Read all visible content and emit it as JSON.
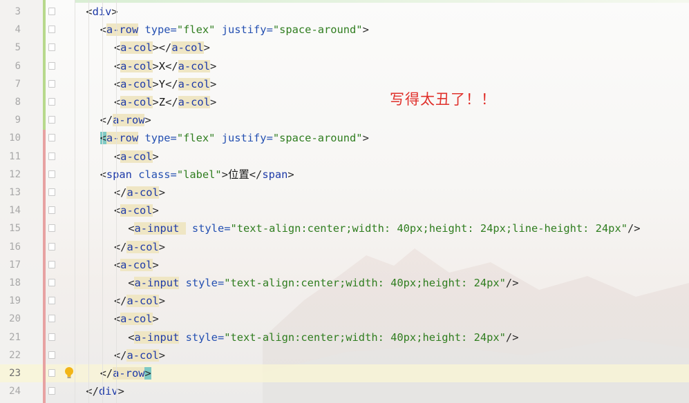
{
  "annotation": "写得太丑了！！",
  "editor": {
    "current_line": 23,
    "lines": [
      {
        "num": "3",
        "indent": 1,
        "tokens": [
          {
            "c": "t-br",
            "t": "<"
          },
          {
            "c": "t-tag",
            "t": "div"
          },
          {
            "c": "t-br",
            "t": ">"
          }
        ]
      },
      {
        "num": "4",
        "indent": 2,
        "tokens": [
          {
            "c": "t-br",
            "t": "<"
          },
          {
            "c": "t-tag",
            "t": "a-row",
            "hl": true
          },
          {
            "c": "t-attr",
            "t": " type="
          },
          {
            "c": "t-val",
            "t": "\"flex\""
          },
          {
            "c": "t-attr",
            "t": " justify="
          },
          {
            "c": "t-val",
            "t": "\"space-around\""
          },
          {
            "c": "t-br",
            "t": ">"
          }
        ]
      },
      {
        "num": "5",
        "indent": 3,
        "tokens": [
          {
            "c": "t-br",
            "t": "<"
          },
          {
            "c": "t-tag",
            "t": "a-col",
            "hl": true
          },
          {
            "c": "t-br",
            "t": "></"
          },
          {
            "c": "t-tag",
            "t": "a-col",
            "hl": true
          },
          {
            "c": "t-br",
            "t": ">"
          }
        ]
      },
      {
        "num": "6",
        "indent": 3,
        "tokens": [
          {
            "c": "t-br",
            "t": "<"
          },
          {
            "c": "t-tag",
            "t": "a-col",
            "hl": true
          },
          {
            "c": "t-br",
            "t": ">"
          },
          {
            "c": "t-text",
            "t": "X"
          },
          {
            "c": "t-br",
            "t": "</"
          },
          {
            "c": "t-tag",
            "t": "a-col",
            "hl": true
          },
          {
            "c": "t-br",
            "t": ">"
          }
        ]
      },
      {
        "num": "7",
        "indent": 3,
        "tokens": [
          {
            "c": "t-br",
            "t": "<"
          },
          {
            "c": "t-tag",
            "t": "a-col",
            "hl": true
          },
          {
            "c": "t-br",
            "t": ">"
          },
          {
            "c": "t-text",
            "t": "Y"
          },
          {
            "c": "t-br",
            "t": "</"
          },
          {
            "c": "t-tag",
            "t": "a-col",
            "hl": true
          },
          {
            "c": "t-br",
            "t": ">"
          }
        ]
      },
      {
        "num": "8",
        "indent": 3,
        "tokens": [
          {
            "c": "t-br",
            "t": "<"
          },
          {
            "c": "t-tag",
            "t": "a-col",
            "hl": true
          },
          {
            "c": "t-br",
            "t": ">"
          },
          {
            "c": "t-text",
            "t": "Z"
          },
          {
            "c": "t-br",
            "t": "</"
          },
          {
            "c": "t-tag",
            "t": "a-col",
            "hl": true
          },
          {
            "c": "t-br",
            "t": ">"
          }
        ]
      },
      {
        "num": "9",
        "indent": 2,
        "tokens": [
          {
            "c": "t-br",
            "t": "</"
          },
          {
            "c": "t-tag",
            "t": "a-row",
            "hl": true
          },
          {
            "c": "t-br",
            "t": ">"
          }
        ]
      },
      {
        "num": "10",
        "indent": 2,
        "tokens": [
          {
            "c": "t-br",
            "t": "<",
            "bhl": true
          },
          {
            "c": "t-tag",
            "t": "a-row",
            "hl": true
          },
          {
            "c": "t-attr",
            "t": " type="
          },
          {
            "c": "t-val",
            "t": "\"flex\""
          },
          {
            "c": "t-attr",
            "t": " justify="
          },
          {
            "c": "t-val",
            "t": "\"space-around\""
          },
          {
            "c": "t-br",
            "t": ">"
          }
        ]
      },
      {
        "num": "11",
        "indent": 3,
        "tokens": [
          {
            "c": "t-br",
            "t": "<"
          },
          {
            "c": "t-tag",
            "t": "a-col",
            "hl": true
          },
          {
            "c": "t-br",
            "t": ">"
          }
        ]
      },
      {
        "num": "12",
        "indent": 2,
        "tokens": [
          {
            "c": "t-br",
            "t": "<"
          },
          {
            "c": "t-tag",
            "t": "span"
          },
          {
            "c": "t-attr",
            "t": " class="
          },
          {
            "c": "t-val",
            "t": "\"label\""
          },
          {
            "c": "t-br",
            "t": ">"
          },
          {
            "c": "t-text",
            "t": "位置"
          },
          {
            "c": "t-br",
            "t": "</"
          },
          {
            "c": "t-tag",
            "t": "span"
          },
          {
            "c": "t-br",
            "t": ">"
          }
        ]
      },
      {
        "num": "13",
        "indent": 3,
        "tokens": [
          {
            "c": "t-br",
            "t": "</"
          },
          {
            "c": "t-tag",
            "t": "a-col",
            "hl": true
          },
          {
            "c": "t-br",
            "t": ">"
          }
        ]
      },
      {
        "num": "14",
        "indent": 3,
        "tokens": [
          {
            "c": "t-br",
            "t": "<"
          },
          {
            "c": "t-tag",
            "t": "a-col",
            "hl": true
          },
          {
            "c": "t-br",
            "t": ">"
          }
        ]
      },
      {
        "num": "15",
        "indent": 4,
        "tokens": [
          {
            "c": "t-br",
            "t": "<"
          },
          {
            "c": "t-tag",
            "t": "a-input ",
            "hl": true
          },
          {
            "c": "t-attr",
            "t": " style="
          },
          {
            "c": "t-val",
            "t": "\"text-align:center;width: 40px;height: 24px;line-height: 24px\""
          },
          {
            "c": "t-br",
            "t": "/>"
          }
        ]
      },
      {
        "num": "16",
        "indent": 3,
        "tokens": [
          {
            "c": "t-br",
            "t": "</"
          },
          {
            "c": "t-tag",
            "t": "a-col",
            "hl": true
          },
          {
            "c": "t-br",
            "t": ">"
          }
        ]
      },
      {
        "num": "17",
        "indent": 3,
        "tokens": [
          {
            "c": "t-br",
            "t": "<"
          },
          {
            "c": "t-tag",
            "t": "a-col",
            "hl": true
          },
          {
            "c": "t-br",
            "t": ">"
          }
        ]
      },
      {
        "num": "18",
        "indent": 4,
        "tokens": [
          {
            "c": "t-br",
            "t": "<"
          },
          {
            "c": "t-tag",
            "t": "a-input",
            "hl": true
          },
          {
            "c": "t-attr",
            "t": " style="
          },
          {
            "c": "t-val",
            "t": "\"text-align:center;width: 40px;height: 24px\""
          },
          {
            "c": "t-br",
            "t": "/>"
          }
        ]
      },
      {
        "num": "19",
        "indent": 3,
        "tokens": [
          {
            "c": "t-br",
            "t": "</"
          },
          {
            "c": "t-tag",
            "t": "a-col",
            "hl": true
          },
          {
            "c": "t-br",
            "t": ">"
          }
        ]
      },
      {
        "num": "20",
        "indent": 3,
        "tokens": [
          {
            "c": "t-br",
            "t": "<"
          },
          {
            "c": "t-tag",
            "t": "a-col",
            "hl": true
          },
          {
            "c": "t-br",
            "t": ">"
          }
        ]
      },
      {
        "num": "21",
        "indent": 4,
        "tokens": [
          {
            "c": "t-br",
            "t": "<"
          },
          {
            "c": "t-tag",
            "t": "a-input",
            "hl": true
          },
          {
            "c": "t-attr",
            "t": " style="
          },
          {
            "c": "t-val",
            "t": "\"text-align:center;width: 40px;height: 24px\""
          },
          {
            "c": "t-br",
            "t": "/>"
          }
        ]
      },
      {
        "num": "22",
        "indent": 3,
        "tokens": [
          {
            "c": "t-br",
            "t": "</"
          },
          {
            "c": "t-tag",
            "t": "a-col",
            "hl": true
          },
          {
            "c": "t-br",
            "t": ">"
          }
        ]
      },
      {
        "num": "23",
        "indent": 2,
        "tokens": [
          {
            "c": "t-br",
            "t": "</"
          },
          {
            "c": "t-tag",
            "t": "a-row",
            "hl": true
          },
          {
            "c": "t-br",
            "t": ">",
            "bhl": true
          }
        ]
      },
      {
        "num": "24",
        "indent": 1,
        "tokens": [
          {
            "c": "t-br",
            "t": "</"
          },
          {
            "c": "t-tag",
            "t": "div"
          },
          {
            "c": "t-br",
            "t": ">"
          }
        ]
      }
    ]
  },
  "colors": {
    "tag": "#1e3aa8",
    "attribute": "#234fb1",
    "string": "#2f7d1f",
    "annotation": "#e0302b",
    "change_added": "#b7d98c",
    "change_modified": "#e7a2a2"
  },
  "icons": {
    "fold_marker": "fold-icon",
    "intention": "lightbulb-icon"
  }
}
